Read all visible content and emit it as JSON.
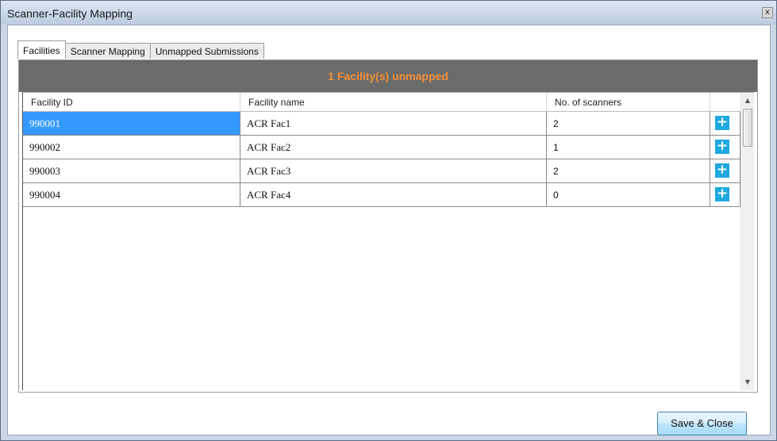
{
  "window": {
    "title": "Scanner-Facility Mapping",
    "close_label": "x"
  },
  "tabs": [
    {
      "label": "Facilities",
      "active": true
    },
    {
      "label": "Scanner Mapping",
      "active": false
    },
    {
      "label": "Unmapped Submissions",
      "active": false
    }
  ],
  "banner": {
    "text": "1 Facility(s) unmapped",
    "color": "#f2913a",
    "background": "#6b6b6b"
  },
  "grid": {
    "columns": [
      "Facility ID",
      "Facility name",
      "No. of scanners",
      ""
    ],
    "rows": [
      {
        "id": "990001",
        "name": "ACR Fac1",
        "scanners": "2",
        "selected": true
      },
      {
        "id": "990002",
        "name": "ACR Fac2",
        "scanners": "1",
        "selected": false
      },
      {
        "id": "990003",
        "name": "ACR Fac3",
        "scanners": "2",
        "selected": false
      },
      {
        "id": "990004",
        "name": "ACR Fac4",
        "scanners": "0",
        "selected": false
      }
    ],
    "row_action_icon": "plus-icon",
    "row_action_label": "+"
  },
  "buttons": {
    "save_close": "Save & Close"
  },
  "colors": {
    "selection": "#3399ff",
    "action_button": "#1ea8e0",
    "accent_text": "#f2913a"
  }
}
